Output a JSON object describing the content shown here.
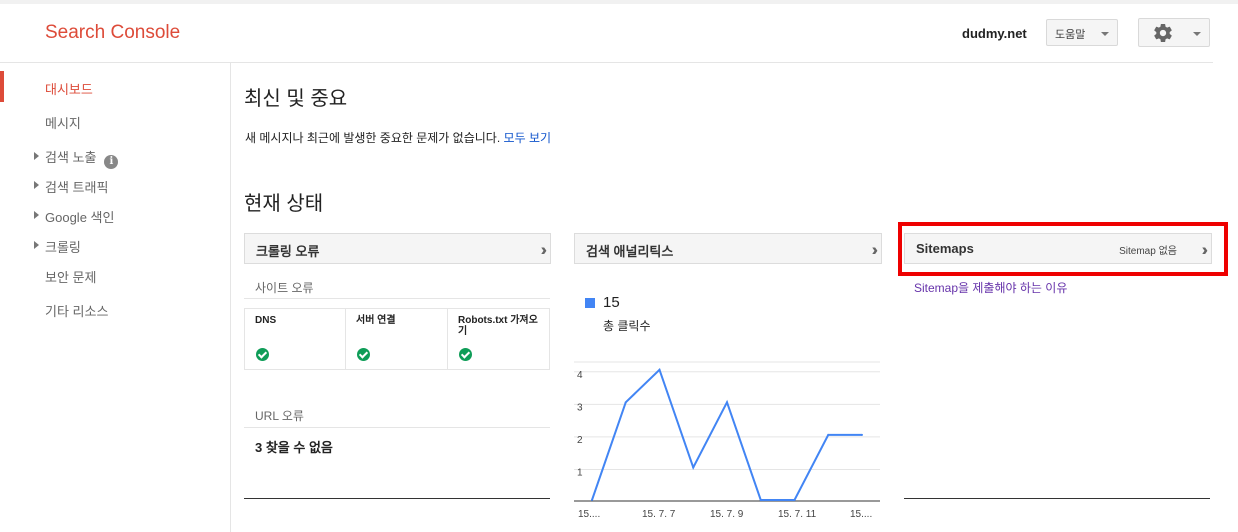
{
  "header": {
    "logo": "Search Console",
    "site": "dudmy.net",
    "help_label": "도움말"
  },
  "sidebar": {
    "items": [
      {
        "label": "대시보드",
        "active": true,
        "expandable": false
      },
      {
        "label": "메시지",
        "active": false,
        "expandable": false
      },
      {
        "label": "검색 노출",
        "active": false,
        "expandable": true,
        "info": true
      },
      {
        "label": "검색 트래픽",
        "active": false,
        "expandable": true
      },
      {
        "label": "Google 색인",
        "active": false,
        "expandable": true
      },
      {
        "label": "크롤링",
        "active": false,
        "expandable": true
      },
      {
        "label": "보안 문제",
        "active": false,
        "expandable": false
      },
      {
        "label": "기타 리소스",
        "active": false,
        "expandable": false
      }
    ]
  },
  "recent": {
    "title": "최신 및 중요",
    "message": "새 메시지나 최근에 발생한 중요한 문제가 없습니다.",
    "view_all": "모두 보기"
  },
  "status": {
    "title": "현재 상태",
    "crawl": {
      "title": "크롤링 오류",
      "site_errors_label": "사이트 오류",
      "columns": [
        {
          "label": "DNS",
          "status": "ok"
        },
        {
          "label": "서버 연결",
          "status": "ok"
        },
        {
          "label": "Robots.txt 가져오기",
          "status": "ok"
        }
      ],
      "url_errors_label": "URL 오류",
      "url_errors_value": "3 찾을 수 없음"
    },
    "analytics": {
      "title": "검색 애널리틱스",
      "metric_value": "15",
      "metric_label": "총 클릭수"
    },
    "sitemaps": {
      "title": "Sitemaps",
      "subtitle": "Sitemap 없음",
      "link": "Sitemap을 제출해야 하는 이유"
    }
  },
  "colors": {
    "brand": "#dd4b39",
    "series": "#4285f4",
    "ok": "#0f9d58",
    "highlight": "#ee0000",
    "link": "#1155cc",
    "visited_link": "#6633aa"
  },
  "chart_data": {
    "type": "line",
    "x_tick_labels": [
      "15....",
      "15. 7. 7",
      "15. 7. 9",
      "15. 7. 11",
      "15...."
    ],
    "y_ticks": [
      1,
      2,
      3,
      4
    ],
    "ylim": [
      0,
      4.3
    ],
    "grid": true,
    "series": [
      {
        "values": [
          0,
          3,
          4,
          1,
          3,
          0,
          0,
          2,
          2
        ]
      }
    ]
  }
}
